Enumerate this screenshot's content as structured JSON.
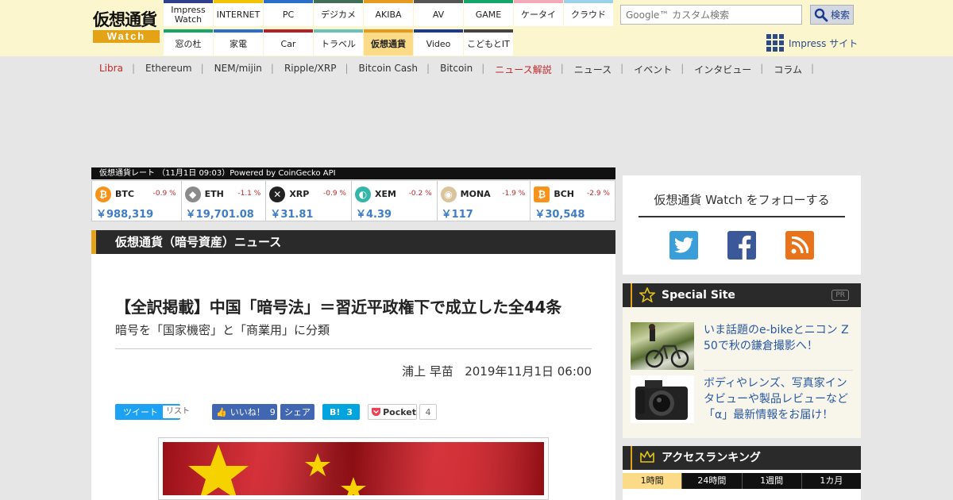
{
  "header": {
    "logo_top": "仮想通貨",
    "logo_bottom": "Watch",
    "nav_row1": [
      {
        "label": "Impress Watch",
        "color": "#2f3e8f"
      },
      {
        "label": "INTERNET",
        "color": "#f0c400"
      },
      {
        "label": "PC",
        "color": "#2a6ec7"
      },
      {
        "label": "デジカメ",
        "color": "#3f6e59"
      },
      {
        "label": "AKIBA",
        "color": "#e69a1e"
      },
      {
        "label": "AV",
        "color": "#555555"
      },
      {
        "label": "GAME",
        "color": "#13a56a"
      },
      {
        "label": "ケータイ",
        "color": "#f3a9b8"
      },
      {
        "label": "クラウド",
        "color": "#98d3ea"
      }
    ],
    "nav_row2": [
      {
        "label": "窓の杜",
        "color": "#13a56a"
      },
      {
        "label": "家電",
        "color": "#2a6ec7"
      },
      {
        "label": "Car",
        "color": "#b3202a"
      },
      {
        "label": "トラベル",
        "color": "#67c2b9"
      },
      {
        "label": "仮想通貨",
        "color": "#e69a1e",
        "active": true
      },
      {
        "label": "Video",
        "color": "#1a3a8c"
      },
      {
        "label": "こどもとIT",
        "color": "#444444"
      }
    ],
    "search_placeholder": "Google™ カスタム検索",
    "search_button": "検索",
    "impress_site": "Impress サイト"
  },
  "subnav": [
    {
      "label": "Libra",
      "highlight": true
    },
    {
      "label": "Ethereum"
    },
    {
      "label": "NEM/mijin"
    },
    {
      "label": "Ripple/XRP"
    },
    {
      "label": "Bitcoin Cash"
    },
    {
      "label": "Bitcoin"
    },
    {
      "label": "ニュース解説",
      "highlight": true
    },
    {
      "label": "ニュース"
    },
    {
      "label": "イベント"
    },
    {
      "label": "インタビュー"
    },
    {
      "label": "コラム"
    }
  ],
  "rates_title": "仮想通貨レート （11月1日 09:03）Powered by CoinGecko API",
  "rates": [
    {
      "symbol": "BTC",
      "change": "-0.9 %",
      "price": "￥988,319",
      "icon": "bitcoin-icon",
      "color": "#f7931a",
      "glyph": "₿"
    },
    {
      "symbol": "ETH",
      "change": "-1.1 %",
      "price": "￥19,701.08",
      "icon": "ethereum-icon",
      "color": "#8a8a8a",
      "glyph": "◆"
    },
    {
      "symbol": "XRP",
      "change": "-0.9 %",
      "price": "￥31.81",
      "icon": "xrp-icon",
      "color": "#222222",
      "glyph": "✕"
    },
    {
      "symbol": "XEM",
      "change": "-0.2 %",
      "price": "￥4.39",
      "icon": "nem-icon",
      "color": "#33b5a8",
      "glyph": "◐"
    },
    {
      "symbol": "MONA",
      "change": "-1.9 %",
      "price": "￥117",
      "icon": "monacoin-icon",
      "color": "#d9c49b",
      "glyph": "◉"
    },
    {
      "symbol": "BCH",
      "change": "-2.9 %",
      "price": "￥30,548",
      "icon": "bitcoin-cash-icon",
      "color": "#f7931a",
      "glyph": "₿"
    }
  ],
  "section_title": "仮想通貨（暗号資産）ニュース",
  "article": {
    "title": "【全訳掲載】中国「暗号法」＝習近平政権下で成立した全44条",
    "subtitle": "暗号を「国家機密」と「商業用」に分類",
    "author": "浦上 早苗",
    "date": "2019年11月1日 06:00"
  },
  "share": {
    "tweet": "ツイート",
    "list": "リスト",
    "like": "いいね！",
    "like_count": "9",
    "share": "シェア",
    "hatena": "B!",
    "hatena_count": "3",
    "pocket": "Pocket",
    "pocket_count": "4"
  },
  "follow": {
    "title": "仮想通貨 Watch をフォローする"
  },
  "special": {
    "title": "Special Site",
    "pr": "PR",
    "items": [
      {
        "text": "いま話題のe-bikeとニコン Z 50で秋の鎌倉撮影へ！"
      },
      {
        "text": "ボディやレンズ、写真家インタビューや製品レビューなど「α」最新情報をお届け！"
      }
    ]
  },
  "ranking": {
    "title": "アクセスランキング",
    "tabs": [
      "1時間",
      "24時間",
      "1週間",
      "1カ月"
    ]
  }
}
